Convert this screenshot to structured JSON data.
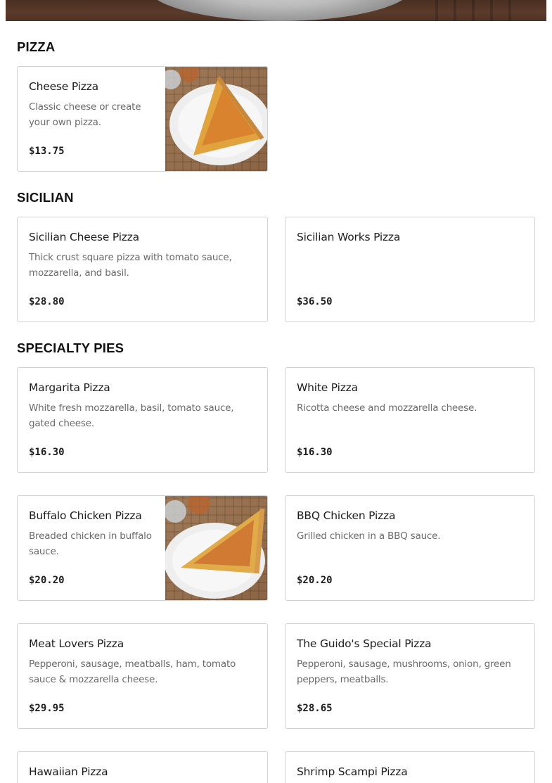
{
  "hero": {
    "image": "pizza-plate-banner"
  },
  "sections": [
    {
      "title": "PIZZA",
      "items": [
        {
          "name": "Cheese Pizza",
          "desc": "Classic cheese or create your own pizza.",
          "price": "$13.75",
          "image": "cheese-slice-photo"
        }
      ]
    },
    {
      "title": "SICILIAN",
      "items": [
        {
          "name": "Sicilian Cheese Pizza",
          "desc": "Thick crust square pizza with tomato sauce, mozzarella, and basil.",
          "price": "$28.80"
        },
        {
          "name": "Sicilian Works Pizza",
          "desc": "",
          "price": "$36.50"
        }
      ]
    },
    {
      "title": "SPECIALTY PIES",
      "items": [
        {
          "name": "Margarita Pizza",
          "desc": "White fresh mozzarella, basil, tomato sauce, gated cheese.",
          "price": "$16.30"
        },
        {
          "name": "White Pizza",
          "desc": "Ricotta cheese and mozzarella cheese.",
          "price": "$16.30"
        },
        {
          "name": "Buffalo Chicken Pizza",
          "desc": "Breaded chicken in buffalo sauce.",
          "price": "$20.20",
          "image": "buffalo-chicken-slice-photo"
        },
        {
          "name": "BBQ Chicken Pizza",
          "desc": "Grilled chicken in a BBQ sauce.",
          "price": "$20.20"
        },
        {
          "name": "Meat Lovers Pizza",
          "desc": "Pepperoni, sausage, meatballs, ham, tomato sauce & mozzarella cheese.",
          "price": "$29.95"
        },
        {
          "name": "The Guido's Special Pizza",
          "desc": "Pepperoni, sausage, mushrooms, onion, green peppers, meatballs.",
          "price": "$28.65"
        },
        {
          "name": "Hawaiian Pizza",
          "desc": "",
          "price": ""
        },
        {
          "name": "Shrimp Scampi Pizza",
          "desc": "",
          "price": ""
        }
      ]
    }
  ]
}
